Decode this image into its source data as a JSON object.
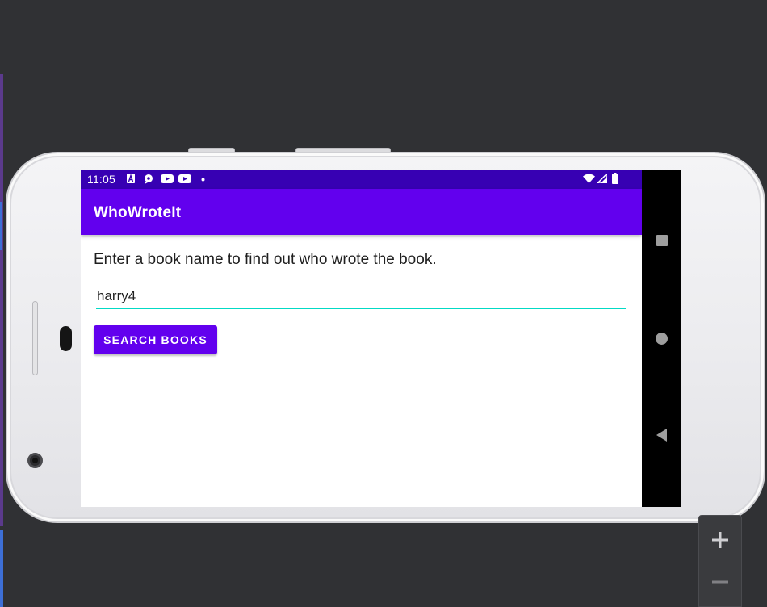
{
  "status_bar": {
    "time": "11:05",
    "left_icons": [
      "a-icon",
      "chat-bubble-icon",
      "youtube-icon",
      "youtube-icon",
      "dot-icon"
    ],
    "right_icons": [
      "wifi-icon",
      "signal-icon",
      "battery-icon"
    ]
  },
  "app": {
    "title": "WhoWroteIt",
    "instructions": "Enter a book name to find out who wrote the book.",
    "search_value": "harry4",
    "search_button_label": "SEARCH BOOKS"
  },
  "nav_bar": {
    "icons": [
      "recents-icon",
      "home-icon",
      "back-icon"
    ]
  },
  "emulator": {
    "zoom_in_icon": "plus-icon",
    "zoom_out_icon": "minus-icon"
  },
  "colors": {
    "status_bar": "#3700b3",
    "primary": "#6200ee",
    "accent": "#03dac5",
    "background": "#303134"
  }
}
